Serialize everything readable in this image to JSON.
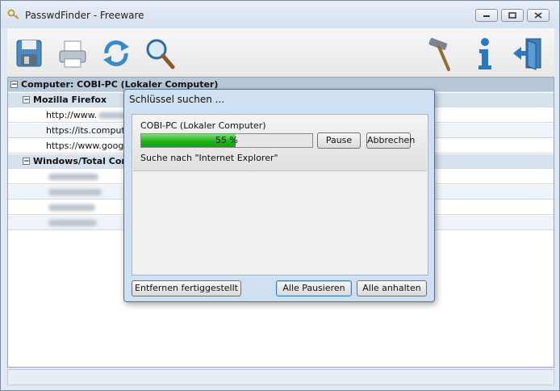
{
  "window": {
    "title": "PasswdFinder - Freeware"
  },
  "toolbar": {
    "buttons": [
      {
        "icon": "save-icon"
      },
      {
        "icon": "print-icon"
      },
      {
        "icon": "refresh-icon"
      },
      {
        "icon": "search-icon"
      },
      {
        "icon": "tools-icon"
      },
      {
        "icon": "info-icon"
      },
      {
        "icon": "exit-icon"
      }
    ]
  },
  "tree": {
    "root": "Computer: COBI-PC (Lokaler Computer)",
    "firefox_group": "Mozilla Firefox",
    "firefox_items": [
      "http://www.",
      "https://its.computer",
      "https://www.google"
    ],
    "windows_group": "Windows/Total Com",
    "windows_item_count": 4
  },
  "dialog": {
    "title": "Schlüssel suchen ...",
    "computer_label": "COBI-PC (Lokaler Computer)",
    "progress_percent": 55,
    "progress_text": "55 %",
    "pause_label": "Pause",
    "cancel_label": "Abbrechen",
    "status_text": "Suche nach \"Internet Explorer\"",
    "remove_finished_label": "Entfernen fertiggestellt",
    "pause_all_label": "Alle Pausieren",
    "stop_all_label": "Alle anhalten"
  },
  "colors": {
    "progress_green": "#1fb31a",
    "accent_blue": "#3c7fb1"
  }
}
